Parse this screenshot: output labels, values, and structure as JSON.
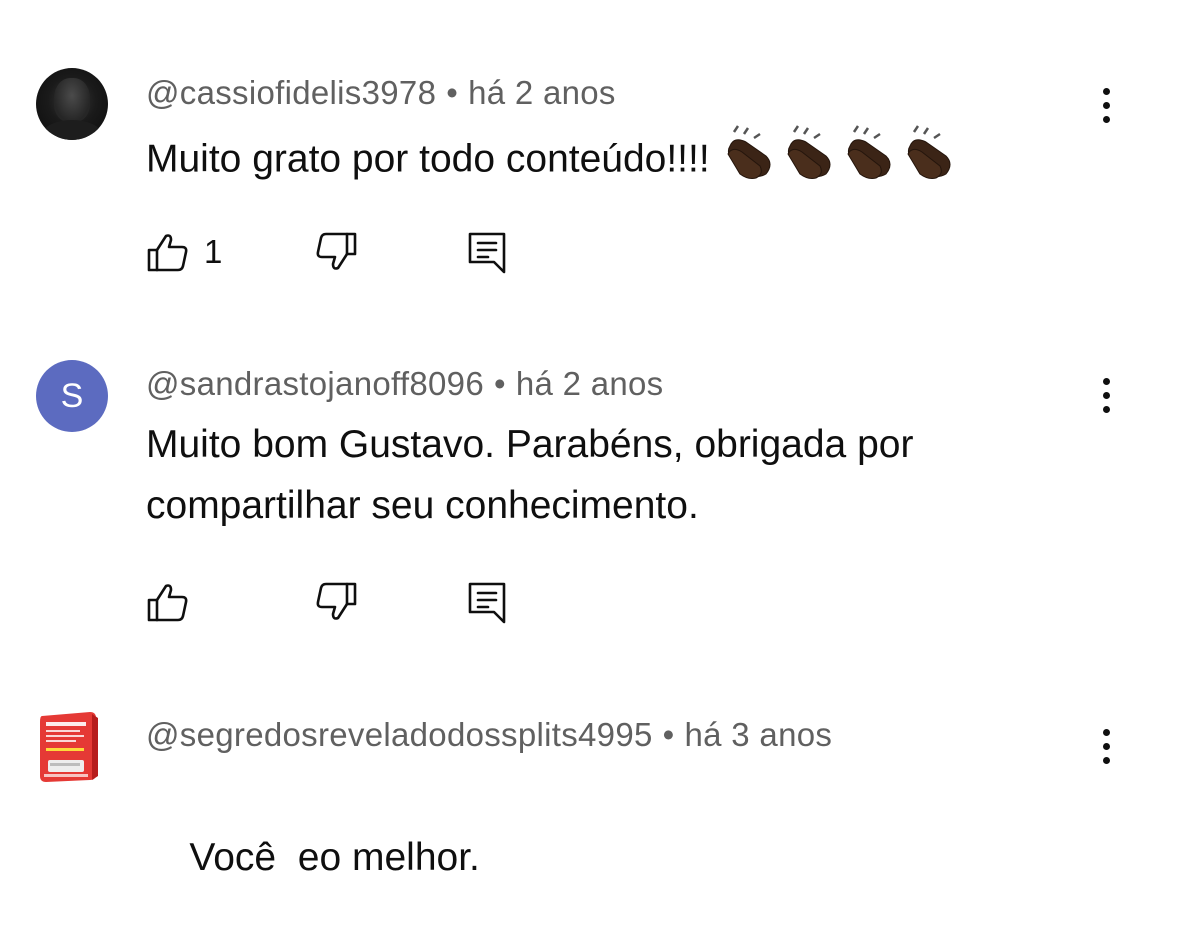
{
  "comments": [
    {
      "author": "@cassiofidelis3978",
      "separator": "•",
      "time": "há 2 anos",
      "text": "Muito grato por todo conteúdo!!!!",
      "emoji": "👏🏿👏🏿👏🏿👏🏿",
      "likes": "1",
      "avatar": "photo"
    },
    {
      "author": "@sandrastojanoff8096",
      "separator": "•",
      "time": "há 2 anos",
      "text_lines": [
        "Muito bom Gustavo. Parabéns, obrigada por",
        "compartilhar seu conhecimento."
      ],
      "likes": "",
      "avatar": "S",
      "avatar_color": "#5c6bc0"
    },
    {
      "author": "@segredosreveladodossplits4995",
      "separator": "•",
      "time": "há 3 anos",
      "text": "Você  eo melhor.",
      "avatar": "ebook-cover",
      "avatar_color": "#e53935"
    }
  ],
  "icons": {
    "like": "thumb-up-icon",
    "dislike": "thumb-down-icon",
    "reply": "reply-icon",
    "more": "more-vertical-icon"
  }
}
